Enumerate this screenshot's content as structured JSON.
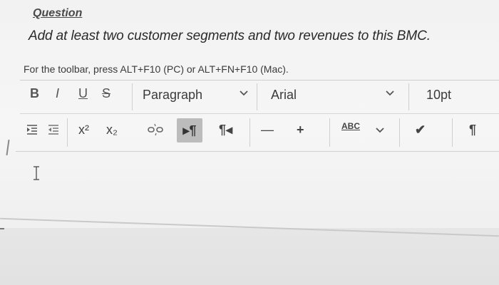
{
  "question": {
    "label": "Question",
    "text": "Add at least two customer segments and two revenues to this BMC.",
    "toolbar_hint": "For the toolbar, press ALT+F10 (PC) or ALT+FN+F10 (Mac)."
  },
  "toolbar": {
    "bold": "B",
    "italic": "I",
    "underline": "U",
    "strikethrough": "S",
    "paragraph_value": "Paragraph",
    "font_value": "Arial",
    "size_value": "10pt",
    "superscript": "x²",
    "subscript": "x₂",
    "ltr": "▸¶",
    "rtl": "¶◂",
    "horizontal_rule": "—",
    "insert": "+",
    "spellcheck": "ABC",
    "formula": "✔",
    "show_blocks": "¶"
  },
  "icons": {
    "dropdown": "chevron-down-icon",
    "link_broken": "unlink-icon",
    "indent": "indent-icon",
    "outdent": "outdent-icon"
  }
}
